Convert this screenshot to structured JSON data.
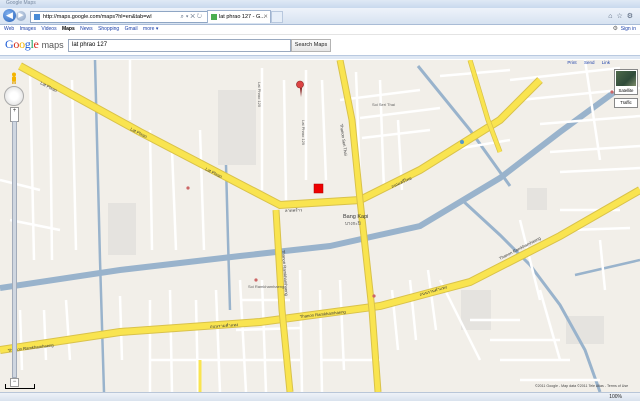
{
  "browser": {
    "window_title": "Google Maps",
    "address": "http://maps.google.com/maps?hl=en&tab=wl",
    "tab_title": "lat phrao 127 - G...",
    "zoom_level": "100%"
  },
  "gbar": {
    "links": [
      "Web",
      "Images",
      "Videos",
      "Maps",
      "News",
      "Shopping",
      "Gmail",
      "more ▾"
    ],
    "current_index": 3,
    "sign_in": "Sign in"
  },
  "header": {
    "logo_text": "Google",
    "logo_suffix": "maps",
    "search_value": "lat phrao 127",
    "search_button": "Search Maps"
  },
  "map": {
    "tools": [
      "Print",
      "Send",
      "Link"
    ],
    "maptype_satellite": "Satellite",
    "maptype_traffic": "Traffic",
    "copyright": "©2011 Google - Map data ©2011 Tele Atlas - Terms of Use",
    "place_label_en": "Bang Kapi",
    "place_label_th": "บางกะปิ",
    "road_labels": {
      "lat_phrao_1": "Lat Phrao",
      "lat_phrao_2": "Lat Phrao",
      "lat_phrao_3": "Lat Phrao",
      "lat_phrao_th_1": "ลาดพร้าว",
      "ramkhamhaeng_1": "Thanon Ramkhamhaeng",
      "ramkhamhaeng_2": "Thanon Ramkhamhaeng",
      "ramkhamhaeng_3": "Thanon Ramkhamhaeng",
      "ramkhamhaeng_th_1": "ถนนรามคำแหง",
      "ramkhamhaeng_th_2": "ถนนรามคำแหง",
      "serithai": "Thanon Seri Thai",
      "serithai_th": "ถนนเสรีไทย",
      "ramkhamhaeng_vert": "Thanon Ramkhamhaeng",
      "side_1": "Soi Ramkhamhaeng",
      "side_2": "Lat Phrao 125",
      "side_3": "Lat Phrao 129",
      "side_4": "Soi Seri Thai"
    },
    "accent_road": "#f9e450",
    "road_border": "#d9c24a",
    "canal_color": "#99b3cc",
    "land_color": "#f2efe9"
  }
}
